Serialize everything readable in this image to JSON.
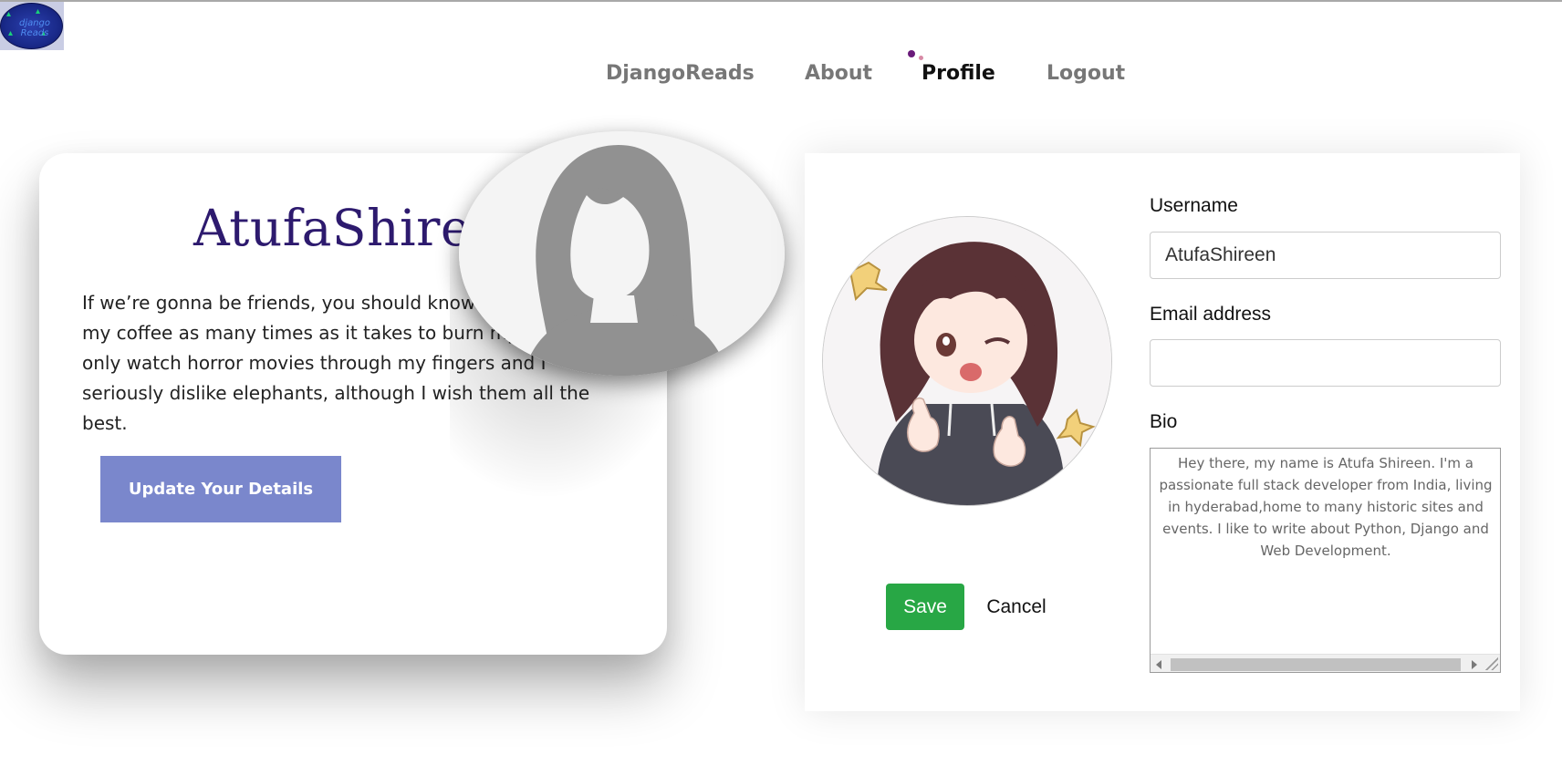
{
  "logo": {
    "text": "django Reads"
  },
  "nav": {
    "items": [
      {
        "label": "DjangoReads",
        "active": false
      },
      {
        "label": "About",
        "active": false
      },
      {
        "label": "Profile",
        "active": true
      },
      {
        "label": "Logout",
        "active": false
      }
    ]
  },
  "profile_card": {
    "username": "AtufaShireen",
    "bio": "If we’re gonna be friends, you should know that I re-heat my coffee as many times as it takes to burn my tongue, I only watch horror movies through my fingers and I seriously dislike elephants, although I wish them all the best.",
    "update_button": "Update Your Details"
  },
  "edit_form": {
    "username_label": "Username",
    "username_value": "AtufaShireen",
    "email_label": "Email address",
    "email_value": "",
    "bio_label": "Bio",
    "bio_value": "Hey there, my name is Atufa Shireen. I'm a passionate full stack developer from India, living in hyderabad,home to many historic sites and events. I like to write about Python, Django and Web Development.",
    "save_button": "Save",
    "cancel_button": "Cancel"
  },
  "colors": {
    "username_title": "#2d1a6e",
    "update_button": "#7a87cc",
    "save_button": "#28a745",
    "nav_active": "#111111",
    "nav_inactive": "#777777"
  },
  "icons": [
    "default-avatar-silhouette-icon",
    "profile-picture-anime-girl"
  ]
}
